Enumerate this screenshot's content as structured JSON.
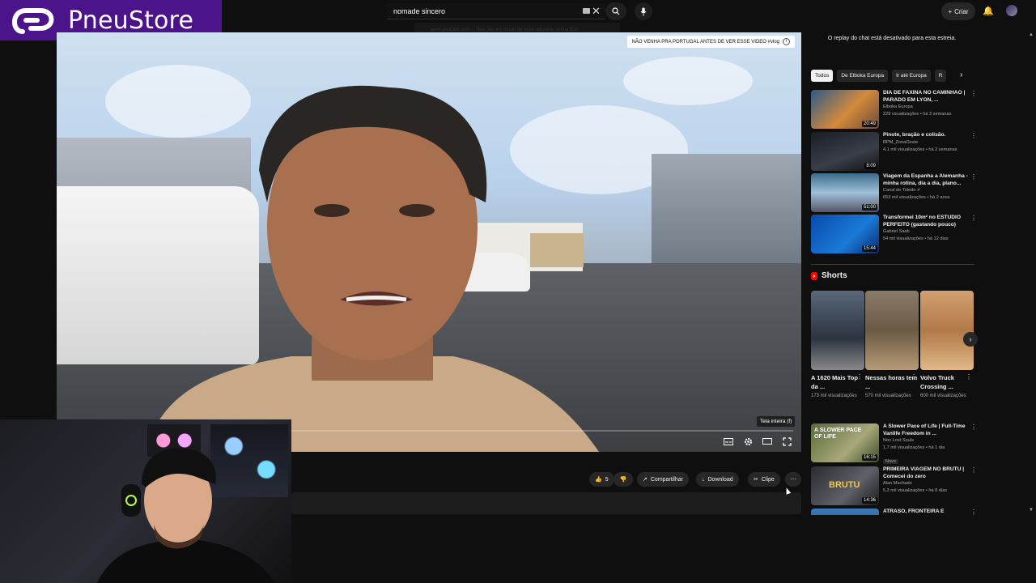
{
  "brand": {
    "name": "PneuStore",
    "color": "#4b148a"
  },
  "header": {
    "search_value": "nomade sincero",
    "url_tooltip": "www.youtube.com -- Tela não em modo de você adicione, prima Esc",
    "create_label": "Criar"
  },
  "player": {
    "video_title_chip": "NÃO VENHA PRA PORTUGAL ANTES DE VER ESSE VIDEO #vlog",
    "tooltip": "Tela inteira (f)",
    "progress": 0
  },
  "actions": {
    "likes": "5",
    "share_label": "Compartilhar",
    "download_label": "Download",
    "clip_label": "Clipe"
  },
  "sidebar": {
    "chat_replay": "O replay do chat está desativado para esta estreia.",
    "chips": [
      "Todos",
      "De Elboka Europa",
      "Ir até Europa",
      "R"
    ],
    "recommendations": [
      {
        "title": "DIA DE FAXINA NO CAMINHÃO | PARADO EM LYON, ...",
        "channel": "Elboka Europa",
        "stats": "229 visualizações • há 3 semanas",
        "duration": "20:49"
      },
      {
        "title": "Pinote, bração e colisão.",
        "channel": "RPM_ZonaOeste",
        "stats": "4,1 mil visualizações • há 2 semanas",
        "duration": "8:09"
      },
      {
        "title": "Viagem da Espanha a Alemanha - minha rotina, dia a dia, plano...",
        "channel": "Canal do Toledo",
        "stats": "653 mil visualizações • há 2 anos",
        "duration": "51:00"
      },
      {
        "title": "Transformei 10m² no ESTÚDIO PERFEITO (gastando pouco)",
        "channel": "Gabriel Saab",
        "stats": "54 mil visualizações • há 12 dias",
        "duration": "15:44"
      }
    ],
    "shorts_title": "Shorts",
    "shorts": [
      {
        "title": "A 1620 Mais Top da ...",
        "views": "173 mil visualizações"
      },
      {
        "title": "Nessas horas tem ...",
        "views": "570 mil visualizações"
      },
      {
        "title": "Volvo Truck Crossing ...",
        "views": "600 mil visualizações"
      }
    ],
    "recommendations2": [
      {
        "title": "A Slower Pace of Life | Full-Time Vanlife Freedom in ...",
        "channel": "Non Lost Souls",
        "stats": "1,7 mil visualizações • há 1 dia",
        "badge": "Novo",
        "duration": "16:15",
        "thumb_text": "A SLOWER PACE OF LIFE"
      },
      {
        "title": "PRIMEIRA VIAGEM NO BRUTU | Comecei do zero",
        "channel": "Alan Machado",
        "stats": "5,3 mil visualizações • há 8 dias",
        "duration": "14:36",
        "thumb_text": "BRUTU"
      },
      {
        "title": "ATRASO, FRONTEIRA E",
        "channel": "",
        "stats": "",
        "duration": ""
      }
    ]
  }
}
